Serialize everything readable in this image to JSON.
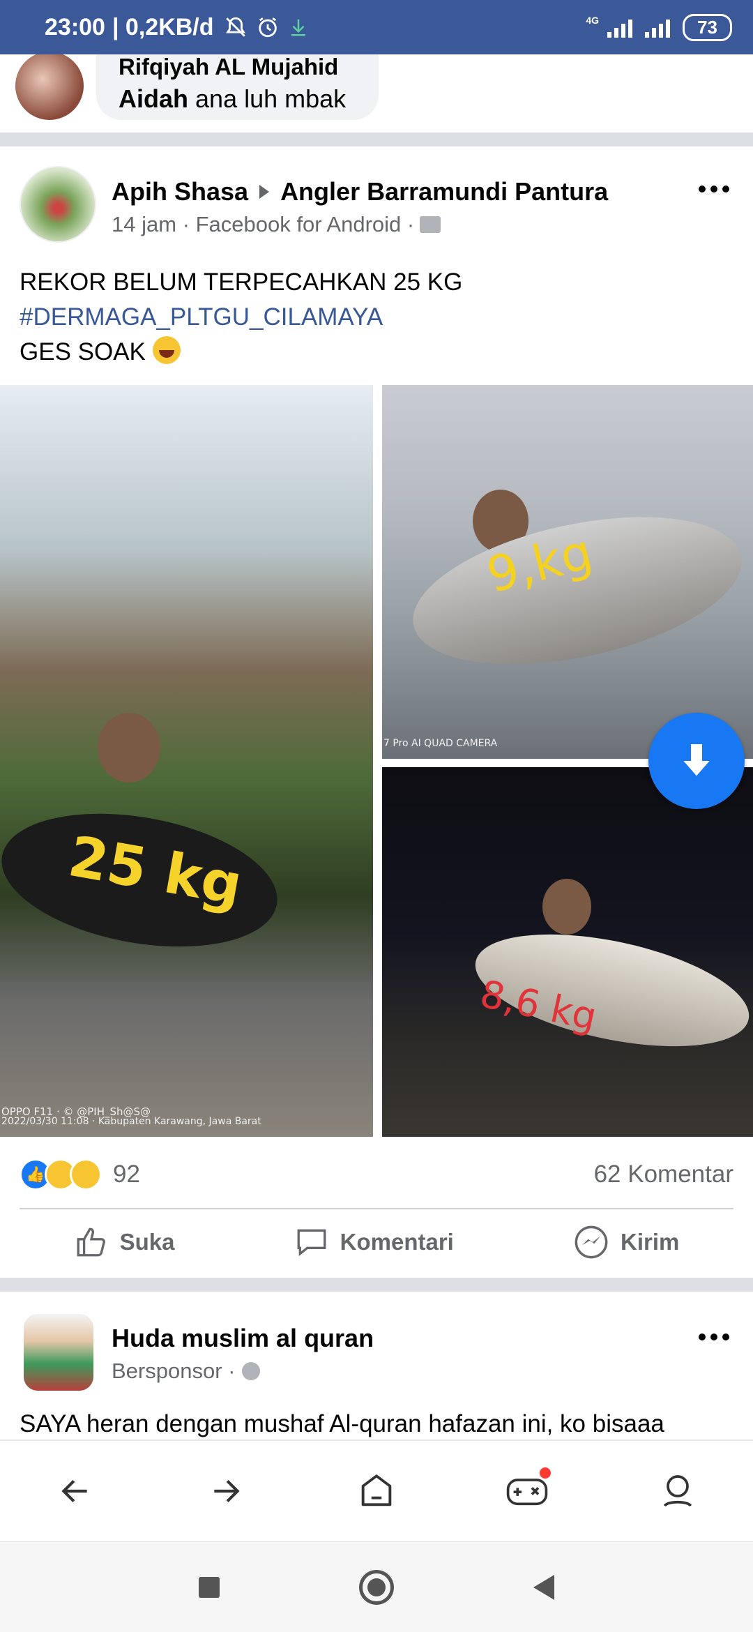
{
  "status_bar": {
    "time": "23:00",
    "speed": "| 0,2KB/d",
    "network_tag": "4G",
    "battery": "73"
  },
  "comment": {
    "author": "Rifqiyah AL Mujahid",
    "reply_to": "Aidah",
    "text": "ana luh mbak"
  },
  "post": {
    "author": "Apih Shasa",
    "group": "Angler Barramundi Pantura",
    "meta": "14 jam · Facebook for Android ·",
    "text_line1": "REKOR BELUM TERPECAHKAN 25 KG",
    "hashtag": "#DERMAGA_PLTGU_CILAMAYA",
    "text_line3": "GES SOAK",
    "photos": [
      {
        "label": "25 kg",
        "caption_line1": "OPPO F11 · © @PIH_Sh@S@",
        "caption_line2": "2022/03/30 11:08 · Kabupaten Karawang, Jawa Barat"
      },
      {
        "label": "9,kg",
        "caption": "7 Pro  AI QUAD CAMERA"
      },
      {
        "label": "8,6 kg"
      }
    ],
    "reaction_count": "92",
    "comment_count": "62 Komentar",
    "actions": {
      "like": "Suka",
      "comment": "Komentari",
      "send": "Kirim"
    }
  },
  "post2": {
    "author": "Huda muslim al quran",
    "meta": "Bersponsor ·",
    "text": "SAYA heran dengan mushaf Al-quran hafazan ini, ko bisaaa"
  },
  "colors": {
    "status_bar": "#3b5998",
    "accent": "#1877f2",
    "hashtag": "#385898"
  }
}
